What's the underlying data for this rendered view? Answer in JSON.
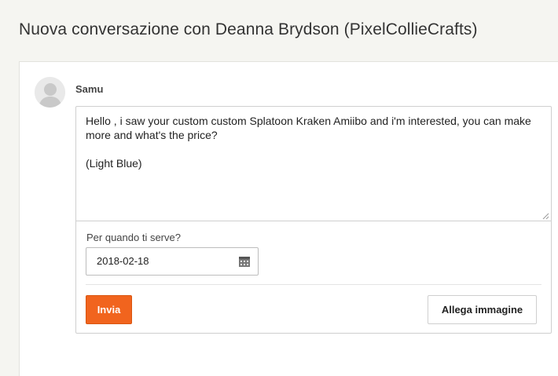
{
  "page": {
    "title": "Nuova conversazione con Deanna Brydson (PixelCollieCrafts)"
  },
  "conversation": {
    "sender_name": "Samu",
    "avatar_icon": "user-silhouette-icon",
    "message_text": "Hello , i saw your custom custom Splatoon Kraken Amiibo and i'm interested, you can make more and what's the price?\n\n(Light Blue)",
    "date_label": "Per quando ti serve?",
    "date_value": "2018-02-18",
    "date_icon": "calendar-icon",
    "send_label": "Invia",
    "attach_label": "Allega immagine"
  },
  "colors": {
    "background": "#f5f5f1",
    "accent": "#f1641e",
    "card": "#ffffff"
  }
}
